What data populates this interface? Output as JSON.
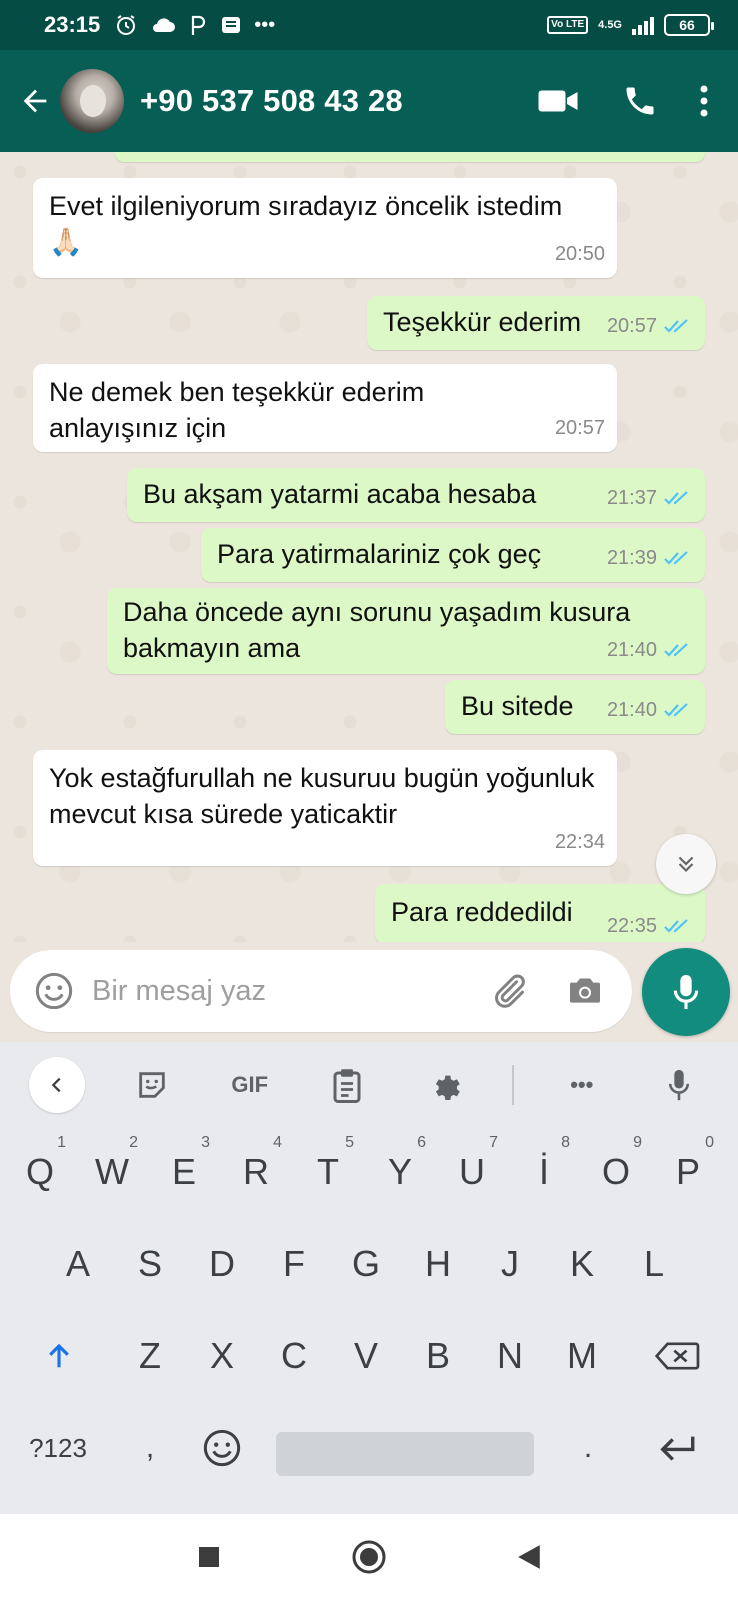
{
  "status_bar": {
    "time": "23:15",
    "more": "•••",
    "volte": "Vo LTE",
    "network": "4.5G",
    "battery": "66"
  },
  "header": {
    "contact_name": "+90 537 508 43 28",
    "background_color": "#075e54"
  },
  "messages": [
    {
      "direction": "in",
      "text": "Evet ilgileniyorum sıradayız öncelik istedim 🙏🏻",
      "time": "20:50"
    },
    {
      "direction": "out",
      "text": "Teşekkür ederim",
      "time": "20:57",
      "read": true
    },
    {
      "direction": "in",
      "text": "Ne demek ben teşekkür ederim anlayışınız için",
      "time": "20:57"
    },
    {
      "direction": "out",
      "text": "Bu akşam yatarmi acaba hesaba",
      "time": "21:37",
      "read": true
    },
    {
      "direction": "out",
      "text": "Para yatirmalariniz çok geç",
      "time": "21:39",
      "read": true
    },
    {
      "direction": "out",
      "text": "Daha öncede aynı sorunu yaşadım kusura bakmayın ama",
      "time": "21:40",
      "read": true
    },
    {
      "direction": "out",
      "text": "Bu sitede",
      "time": "21:40",
      "read": true
    },
    {
      "direction": "in",
      "text": "Yok estağfurullah ne kusuruu bugün yoğunluk mevcut kısa sürede yaticaktir",
      "time": "22:34"
    },
    {
      "direction": "out",
      "text": "Para reddedildi",
      "time": "22:35",
      "read": true
    }
  ],
  "composer": {
    "placeholder": "Bir mesaj yaz"
  },
  "keyboard": {
    "toolbar": {
      "gif_label": "GIF",
      "more_label": "•••"
    },
    "row1": [
      {
        "key": "Q",
        "hint": "1"
      },
      {
        "key": "W",
        "hint": "2"
      },
      {
        "key": "E",
        "hint": "3"
      },
      {
        "key": "R",
        "hint": "4"
      },
      {
        "key": "T",
        "hint": "5"
      },
      {
        "key": "Y",
        "hint": "6"
      },
      {
        "key": "U",
        "hint": "7"
      },
      {
        "key": "İ",
        "hint": "8"
      },
      {
        "key": "O",
        "hint": "9"
      },
      {
        "key": "P",
        "hint": "0"
      }
    ],
    "row2": [
      "A",
      "S",
      "D",
      "F",
      "G",
      "H",
      "J",
      "K",
      "L"
    ],
    "row3": [
      "Z",
      "X",
      "C",
      "V",
      "B",
      "N",
      "M"
    ],
    "symbols_key": "?123",
    "comma_key": ",",
    "period_key": "."
  },
  "colors": {
    "accent": "#128c7e",
    "outgoing_bubble": "#dcf8c6",
    "incoming_bubble": "#ffffff",
    "read_tick": "#4fc3f7"
  }
}
